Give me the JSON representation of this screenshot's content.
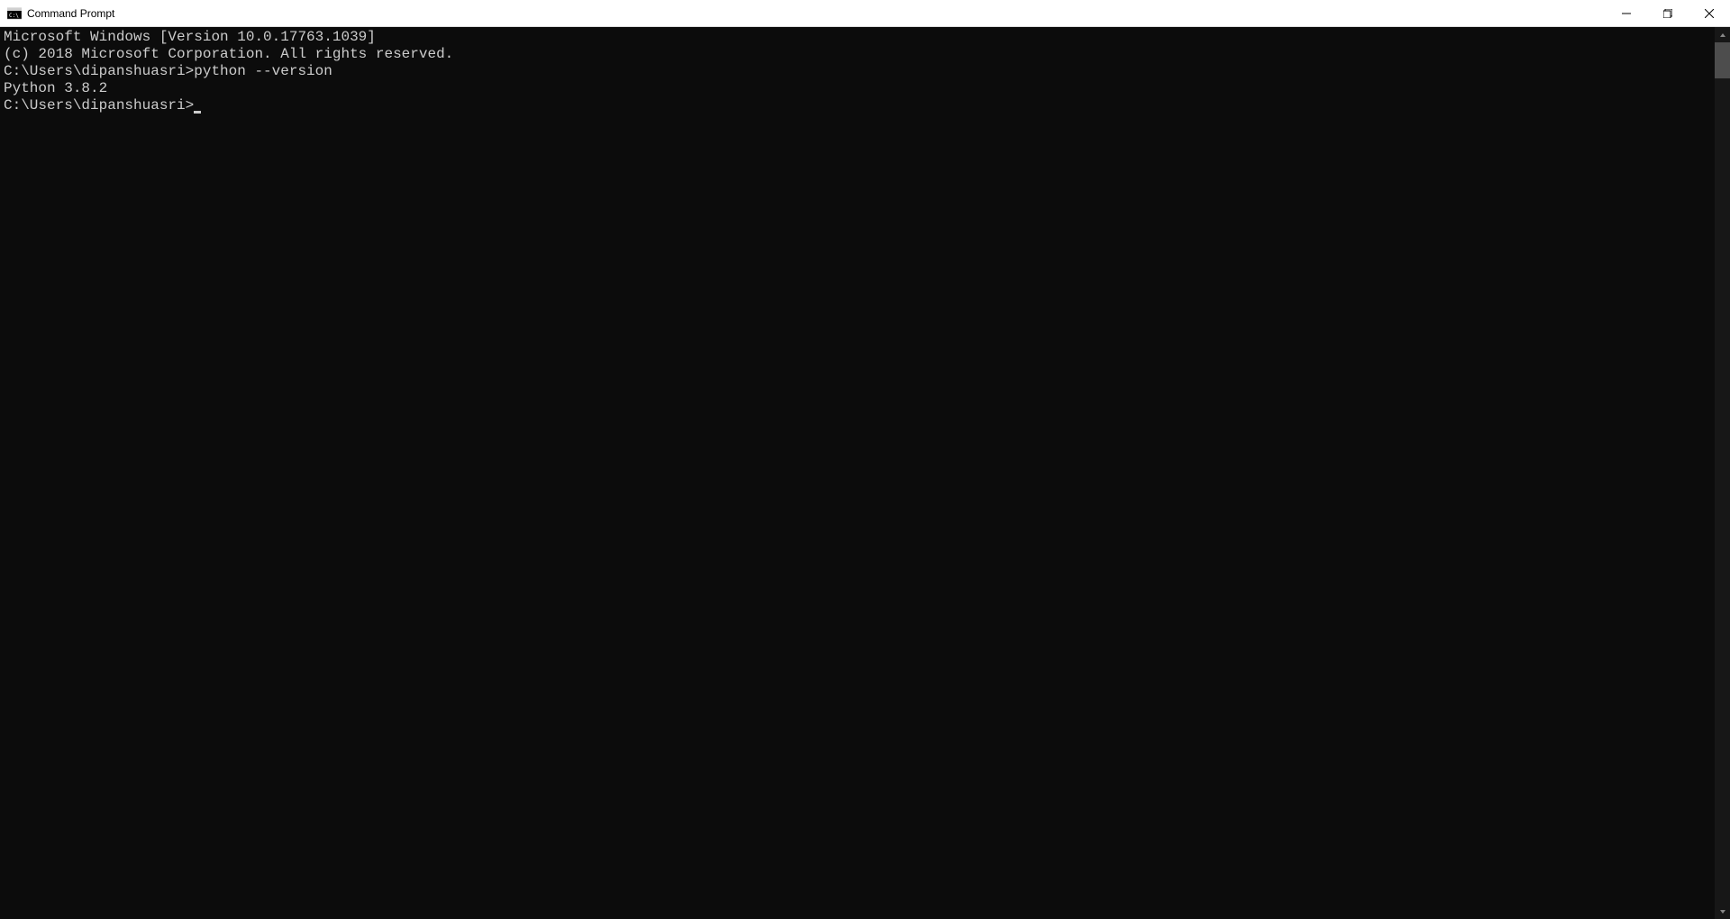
{
  "titlebar": {
    "title": "Command Prompt"
  },
  "terminal": {
    "line1": "Microsoft Windows [Version 10.0.17763.1039]",
    "line2": "(c) 2018 Microsoft Corporation. All rights reserved.",
    "blank1": "",
    "prompt1": "C:\\Users\\dipanshuasri>",
    "command1": "python --version",
    "output1": "Python 3.8.2",
    "blank2": "",
    "prompt2": "C:\\Users\\dipanshuasri>"
  }
}
